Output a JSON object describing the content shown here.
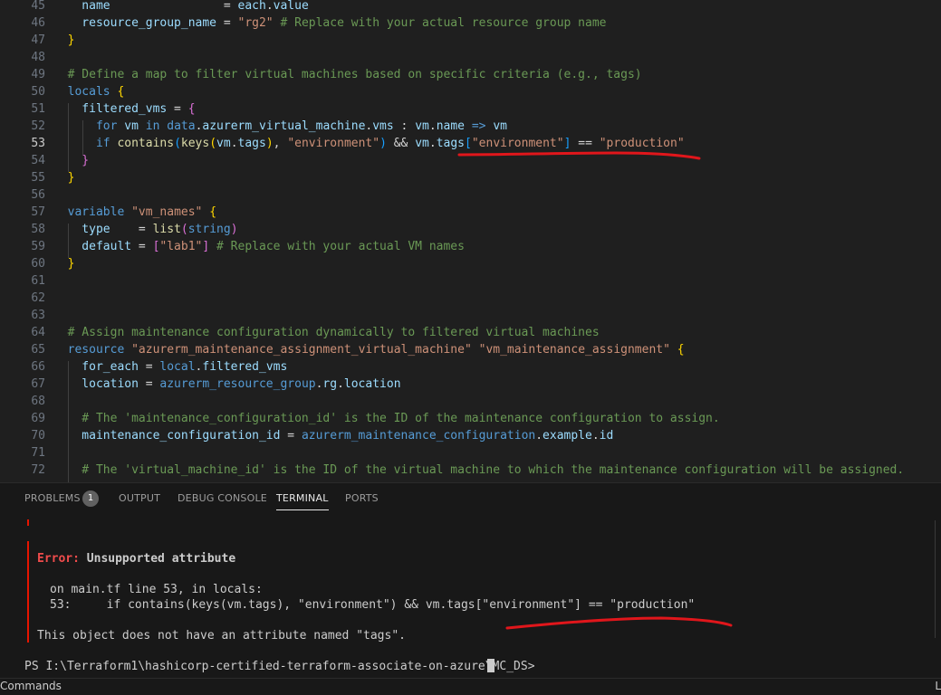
{
  "editor": {
    "lines": [
      {
        "num": "45",
        "segs": [
          {
            "c": "v",
            "t": "    name"
          },
          {
            "c": "d",
            "t": "                = "
          },
          {
            "c": "v",
            "t": "each"
          },
          {
            "c": "d",
            "t": "."
          },
          {
            "c": "v",
            "t": "value"
          }
        ]
      },
      {
        "num": "46",
        "segs": [
          {
            "c": "v",
            "t": "    resource_group_name"
          },
          {
            "c": "d",
            "t": " = "
          },
          {
            "c": "s",
            "t": "\"rg2\""
          },
          {
            "c": "c",
            "t": " # Replace with your actual resource group name"
          }
        ]
      },
      {
        "num": "47",
        "segs": [
          {
            "c": "b1",
            "t": "  }"
          }
        ]
      },
      {
        "num": "48",
        "segs": []
      },
      {
        "num": "49",
        "segs": [
          {
            "c": "c",
            "t": "  # Define a map to filter virtual machines based on specific criteria (e.g., tags)"
          }
        ]
      },
      {
        "num": "50",
        "segs": [
          {
            "c": "k",
            "t": "  locals"
          },
          {
            "c": "d",
            "t": " "
          },
          {
            "c": "b1",
            "t": "{"
          }
        ]
      },
      {
        "num": "51",
        "segs": [
          {
            "c": "v",
            "t": "    filtered_vms"
          },
          {
            "c": "d",
            "t": " = "
          },
          {
            "c": "b2",
            "t": "{"
          }
        ]
      },
      {
        "num": "52",
        "segs": [
          {
            "c": "k",
            "t": "      for"
          },
          {
            "c": "d",
            "t": " "
          },
          {
            "c": "v",
            "t": "vm"
          },
          {
            "c": "d",
            "t": " "
          },
          {
            "c": "k",
            "t": "in"
          },
          {
            "c": "d",
            "t": " "
          },
          {
            "c": "k",
            "t": "data"
          },
          {
            "c": "d",
            "t": "."
          },
          {
            "c": "v",
            "t": "azurerm_virtual_machine"
          },
          {
            "c": "d",
            "t": "."
          },
          {
            "c": "v",
            "t": "vms"
          },
          {
            "c": "d",
            "t": " : "
          },
          {
            "c": "v",
            "t": "vm"
          },
          {
            "c": "d",
            "t": "."
          },
          {
            "c": "v",
            "t": "name"
          },
          {
            "c": "d",
            "t": " "
          },
          {
            "c": "k",
            "t": "=>"
          },
          {
            "c": "d",
            "t": " "
          },
          {
            "c": "v",
            "t": "vm"
          }
        ]
      },
      {
        "num": "53",
        "active": true,
        "segs": [
          {
            "c": "k",
            "t": "      if"
          },
          {
            "c": "d",
            "t": " "
          },
          {
            "c": "f",
            "t": "contains"
          },
          {
            "c": "b3",
            "t": "("
          },
          {
            "c": "f",
            "t": "keys"
          },
          {
            "c": "b1",
            "t": "("
          },
          {
            "c": "v",
            "t": "vm"
          },
          {
            "c": "d",
            "t": "."
          },
          {
            "c": "v",
            "t": "tags"
          },
          {
            "c": "b1",
            "t": ")"
          },
          {
            "c": "d",
            "t": ", "
          },
          {
            "c": "s",
            "t": "\"environment\""
          },
          {
            "c": "b3",
            "t": ")"
          },
          {
            "c": "d",
            "t": " && "
          },
          {
            "c": "v",
            "t": "vm"
          },
          {
            "c": "d",
            "t": "."
          },
          {
            "c": "v",
            "t": "tags"
          },
          {
            "c": "b3",
            "t": "["
          },
          {
            "c": "s",
            "t": "\"environment\""
          },
          {
            "c": "b3",
            "t": "]"
          },
          {
            "c": "d",
            "t": " == "
          },
          {
            "c": "s",
            "t": "\"production\""
          }
        ]
      },
      {
        "num": "54",
        "segs": [
          {
            "c": "b2",
            "t": "    }"
          }
        ]
      },
      {
        "num": "55",
        "segs": [
          {
            "c": "b1",
            "t": "  }"
          }
        ]
      },
      {
        "num": "56",
        "segs": []
      },
      {
        "num": "57",
        "segs": [
          {
            "c": "k",
            "t": "  variable"
          },
          {
            "c": "d",
            "t": " "
          },
          {
            "c": "s",
            "t": "\"vm_names\""
          },
          {
            "c": "d",
            "t": " "
          },
          {
            "c": "b1",
            "t": "{"
          }
        ]
      },
      {
        "num": "58",
        "segs": [
          {
            "c": "v",
            "t": "    type"
          },
          {
            "c": "d",
            "t": "    = "
          },
          {
            "c": "f",
            "t": "list"
          },
          {
            "c": "b2",
            "t": "("
          },
          {
            "c": "k",
            "t": "string"
          },
          {
            "c": "b2",
            "t": ")"
          }
        ]
      },
      {
        "num": "59",
        "segs": [
          {
            "c": "v",
            "t": "    default"
          },
          {
            "c": "d",
            "t": " = "
          },
          {
            "c": "b2",
            "t": "["
          },
          {
            "c": "s",
            "t": "\"lab1\""
          },
          {
            "c": "b2",
            "t": "]"
          },
          {
            "c": "c",
            "t": " # Replace with your actual VM names"
          }
        ]
      },
      {
        "num": "60",
        "segs": [
          {
            "c": "b1",
            "t": "  }"
          }
        ]
      },
      {
        "num": "61",
        "segs": []
      },
      {
        "num": "62",
        "segs": []
      },
      {
        "num": "63",
        "segs": []
      },
      {
        "num": "64",
        "segs": [
          {
            "c": "c",
            "t": "  # Assign maintenance configuration dynamically to filtered virtual machines"
          }
        ]
      },
      {
        "num": "65",
        "segs": [
          {
            "c": "k",
            "t": "  resource"
          },
          {
            "c": "d",
            "t": " "
          },
          {
            "c": "s",
            "t": "\"azurerm_maintenance_assignment_virtual_machine\""
          },
          {
            "c": "d",
            "t": " "
          },
          {
            "c": "s",
            "t": "\"vm_maintenance_assignment\""
          },
          {
            "c": "d",
            "t": " "
          },
          {
            "c": "b1",
            "t": "{"
          }
        ]
      },
      {
        "num": "66",
        "segs": [
          {
            "c": "v",
            "t": "    for_each"
          },
          {
            "c": "d",
            "t": " = "
          },
          {
            "c": "k",
            "t": "local"
          },
          {
            "c": "d",
            "t": "."
          },
          {
            "c": "v",
            "t": "filtered_vms"
          }
        ]
      },
      {
        "num": "67",
        "segs": [
          {
            "c": "v",
            "t": "    location"
          },
          {
            "c": "d",
            "t": " = "
          },
          {
            "c": "k",
            "t": "azurerm_resource_group"
          },
          {
            "c": "d",
            "t": "."
          },
          {
            "c": "v",
            "t": "rg"
          },
          {
            "c": "d",
            "t": "."
          },
          {
            "c": "v",
            "t": "location"
          }
        ]
      },
      {
        "num": "68",
        "segs": []
      },
      {
        "num": "69",
        "segs": [
          {
            "c": "c",
            "t": "    # The 'maintenance_configuration_id' is the ID of the maintenance configuration to assign."
          }
        ]
      },
      {
        "num": "70",
        "segs": [
          {
            "c": "v",
            "t": "    maintenance_configuration_id"
          },
          {
            "c": "d",
            "t": " = "
          },
          {
            "c": "k",
            "t": "azurerm_maintenance_configuration"
          },
          {
            "c": "d",
            "t": "."
          },
          {
            "c": "v",
            "t": "example"
          },
          {
            "c": "d",
            "t": "."
          },
          {
            "c": "v",
            "t": "id"
          }
        ]
      },
      {
        "num": "71",
        "segs": []
      },
      {
        "num": "72",
        "segs": [
          {
            "c": "c",
            "t": "    # The 'virtual_machine_id' is the ID of the virtual machine to which the maintenance configuration will be assigned."
          }
        ]
      }
    ]
  },
  "panel": {
    "tabs": {
      "problems": "PROBLEMS",
      "problems_count": "1",
      "output": "OUTPUT",
      "debug_console": "DEBUG CONSOLE",
      "terminal": "TERMINAL",
      "ports": "PORTS"
    },
    "terminal": {
      "error_label": "Error:",
      "error_title": " Unsupported attribute",
      "location_line": "on main.tf line 53, in locals:",
      "code_line": "53:     if contains(keys(vm.tags), \"environment\") && vm.tags[\"environment\"] == \"production\"",
      "message": "This object does not have an attribute named \"tags\".",
      "prompt": "PS I:\\Terraform1\\hashicorp-certified-terraform-associate-on-azure\\MC_DS>"
    }
  },
  "status": {
    "left": "Commands",
    "right": "L"
  },
  "colors": {
    "annotation": "#e0161b",
    "error": "#f14c4c"
  }
}
